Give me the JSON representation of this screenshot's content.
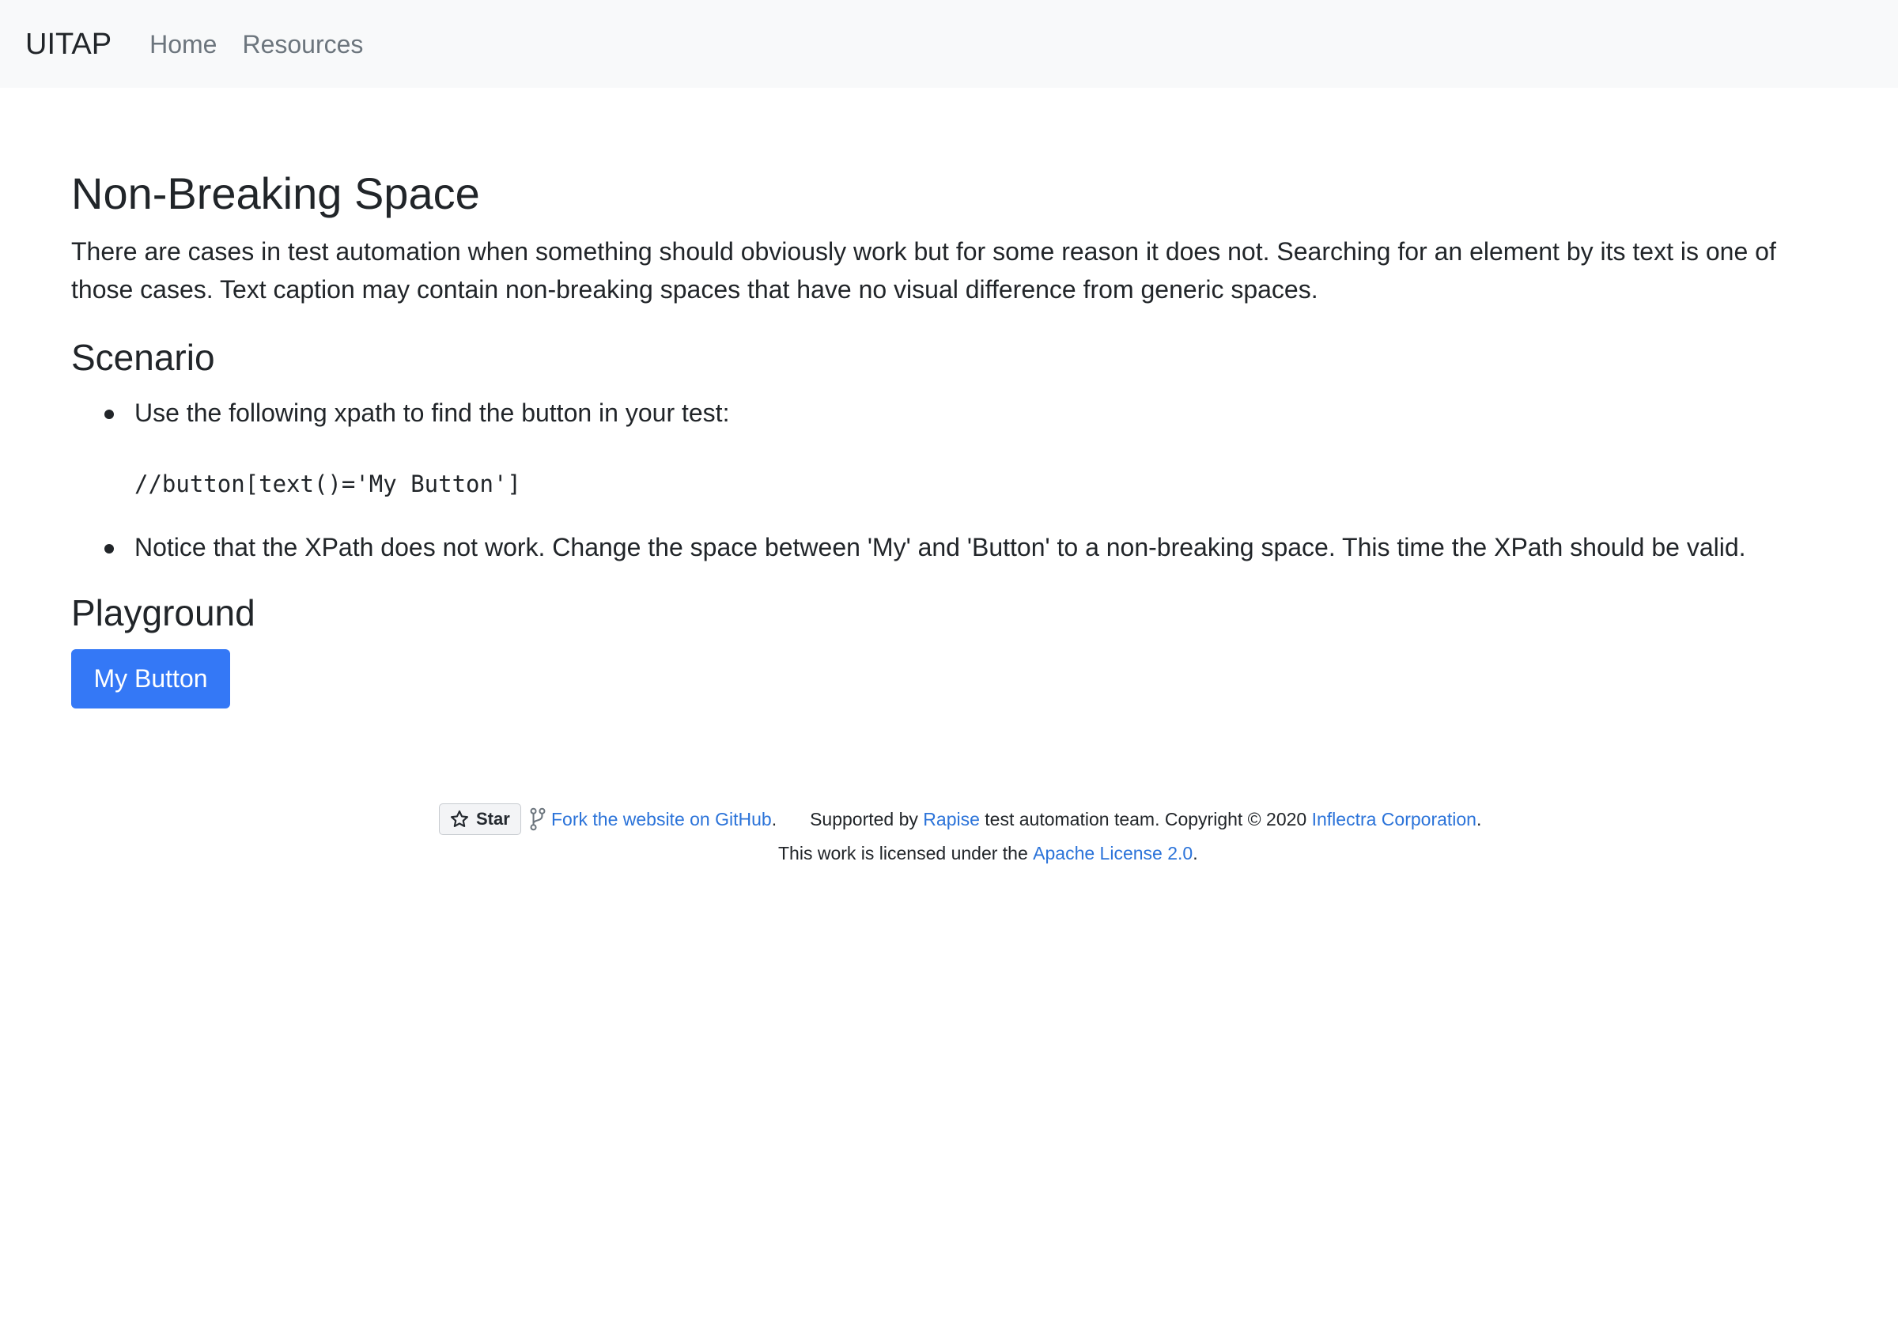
{
  "navbar": {
    "brand": "UITAP",
    "links": [
      "Home",
      "Resources"
    ]
  },
  "main": {
    "title": "Non-Breaking Space",
    "intro": "There are cases in test automation when something should obviously work but for some reason it does not. Searching for an element by its text is one of those cases. Text caption may contain non-breaking spaces that have no visual difference from generic spaces.",
    "scenario_heading": "Scenario",
    "scenario_items": [
      "Use the following xpath to find the button in your test:",
      "Notice that the XPath does not work. Change the space between 'My' and 'Button' to a non-breaking space. This time the XPath should be valid."
    ],
    "xpath_code": "//button[text()='My Button']",
    "playground_heading": "Playground",
    "button_label": "My Button"
  },
  "footer": {
    "star_label": "Star",
    "fork_link": "Fork the website on GitHub",
    "period": ".",
    "supported_by": "Supported by",
    "rapise_link": "Rapise",
    "team_copyright": "test automation team. Copyright © 2020",
    "inflectra_link": "Inflectra Corporation",
    "license_text": "This work is licensed under the",
    "license_link": "Apache License 2.0"
  },
  "colors": {
    "navbar_bg": "#f8f9fa",
    "primary_button": "#3478f6",
    "link": "#2b73d9",
    "text": "#212529",
    "muted": "#6c757d"
  }
}
